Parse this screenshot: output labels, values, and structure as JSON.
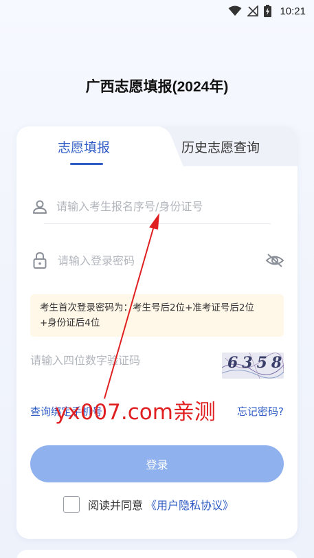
{
  "status_bar": {
    "time": "10:21"
  },
  "app_title": "广西志愿填报(2024年)",
  "tabs": [
    {
      "label": "志愿填报",
      "active": true
    },
    {
      "label": "历史志愿查询",
      "active": false
    }
  ],
  "form": {
    "username_placeholder": "请输入考生报名序号/身份证号",
    "password_placeholder": "请输入登录密码",
    "notice_line1": "考生首次登录密码为：考生号后2位+准考证号后2位",
    "notice_line2": "+身份证后4位",
    "captcha_placeholder": "请输入四位数字验证码",
    "captcha_value": "6358"
  },
  "links": {
    "bind_phone": "查询绑定手机号",
    "forgot_password": "忘记密码?"
  },
  "login_label": "登录",
  "agreement": {
    "text": "阅读并同意",
    "link": "《用户隐私协议》"
  },
  "watermark": "yx007.com亲测",
  "colors": {
    "accent": "#2f5cc4",
    "button": "#8fb1ee",
    "notice_bg": "#fff7e8",
    "watermark": "#e02020"
  },
  "icons": {
    "wifi": "wifi-icon",
    "signal": "no-signal-icon",
    "battery": "battery-charging-icon",
    "user": "user-icon",
    "lock": "lock-icon",
    "eye": "eye-off-icon"
  }
}
